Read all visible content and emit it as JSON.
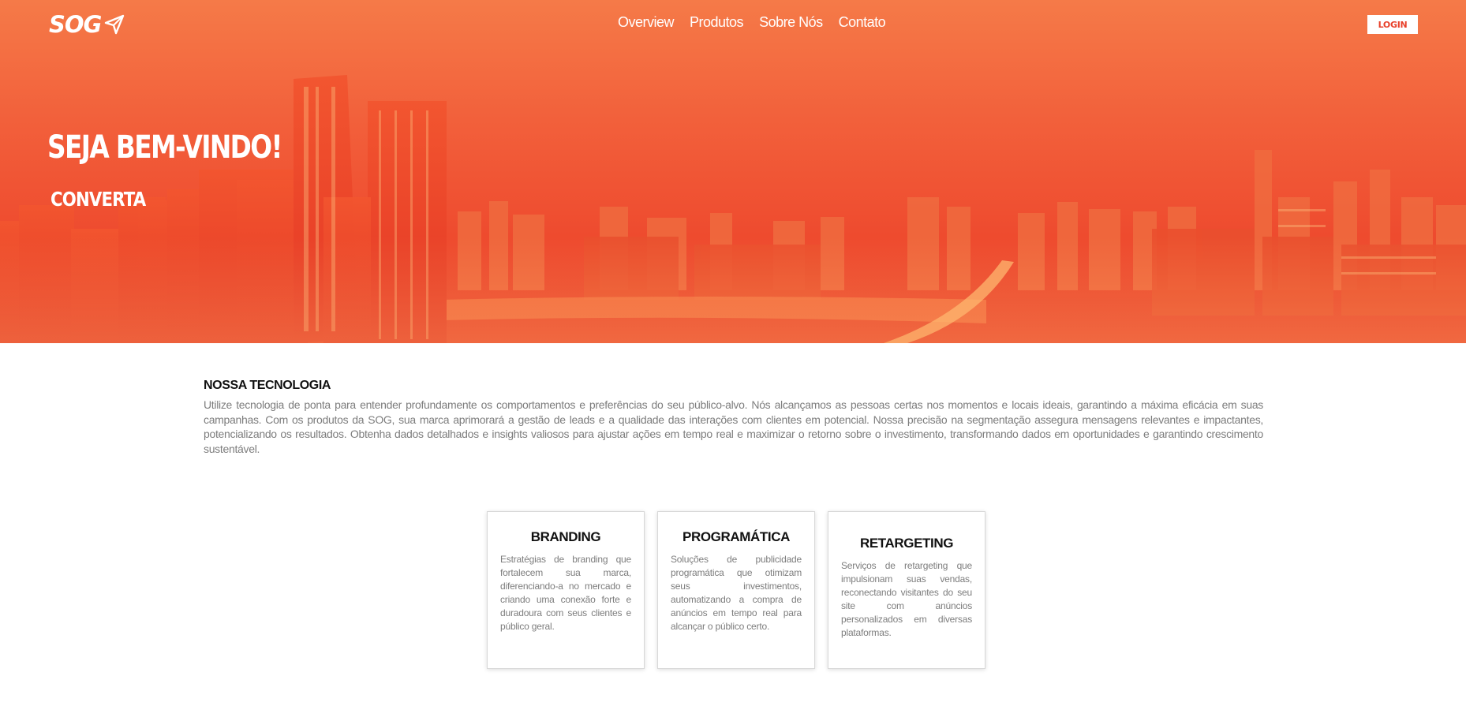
{
  "header": {
    "logo_text": "SOG",
    "logo_icon": "paper-plane-icon",
    "nav": [
      {
        "label": "Overview"
      },
      {
        "label": "Produtos"
      },
      {
        "label": "Sobre Nós"
      },
      {
        "label": "Contato"
      }
    ],
    "login_label": "LOGIN"
  },
  "hero": {
    "title": "SEJA BEM-VINDO!",
    "subtitle": "CONVERTA"
  },
  "technology": {
    "heading": "NOSSA TECNOLOGIA",
    "body": "Utilize tecnologia de ponta para entender profundamente os comportamentos e preferências do seu público-alvo. Nós alcançamos as pessoas certas nos momentos e locais ideais, garantindo a máxima eficácia em suas campanhas. Com os produtos da SOG, sua marca aprimorará a gestão de leads e a qualidade das interações com clientes em potencial. Nossa precisão na segmentação assegura mensagens relevantes e impactantes, potencializando os resultados. Obtenha dados detalhados e insights valiosos para ajustar ações em tempo real e maximizar o retorno sobre o investimento, transformando dados em oportunidades e garantindo crescimento sustentável."
  },
  "cards": [
    {
      "title": "BRANDING",
      "text": "Estratégias de branding que fortalecem sua marca, diferenciando-a no mercado e criando uma conexão forte e duradoura com seus clientes e público geral."
    },
    {
      "title": "PROGRAMÁTICA",
      "text": "Soluções de publicidade programática que otimizam seus investimentos, automatizando a compra de anúncios em tempo real para alcançar o público certo."
    },
    {
      "title": "RETARGETING",
      "text": "Serviços de retargeting que impulsionam suas vendas, reconectando visitantes do seu site com anúncios personalizados em diversas plataformas."
    }
  ],
  "colors": {
    "brand": "#ee4a2e",
    "hero_top": "#f57a48",
    "text_muted": "#7d7d7d"
  }
}
